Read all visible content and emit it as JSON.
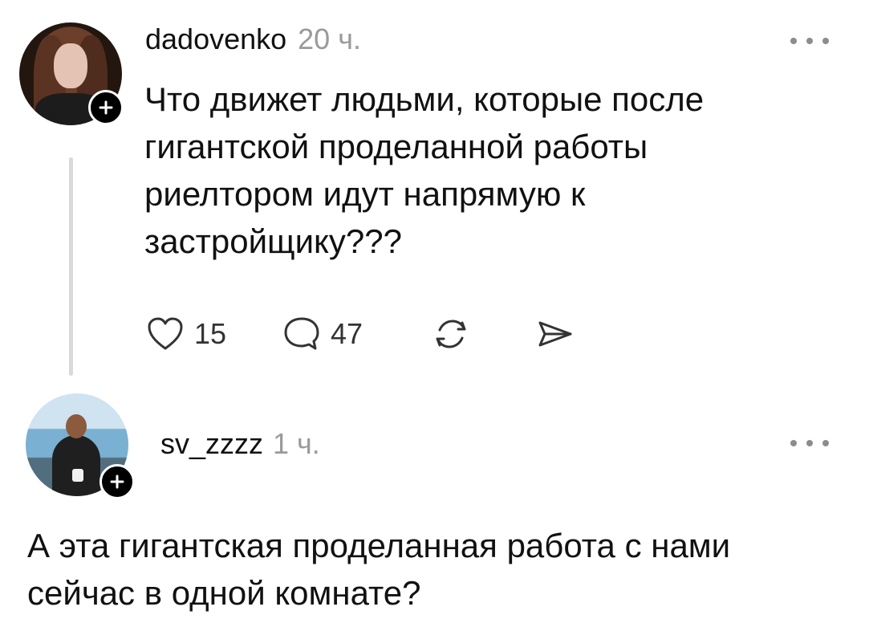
{
  "posts": [
    {
      "username": "dadovenko",
      "time": "20 ч.",
      "text": "Что движет людьми, которые после гигантской проделанной работы риелтором идут напрямую к застройщику???",
      "likes": "15",
      "comments": "47"
    },
    {
      "username": "sv_zzzz",
      "time": "1 ч.",
      "text": "А эта гигантская проделанная работа с нами сейчас в одной комнате?"
    }
  ],
  "icons": {
    "follow": "plus-icon",
    "more": "more-horizontal-icon",
    "like": "heart-icon",
    "comment": "comment-icon",
    "repost": "repost-icon",
    "share": "share-icon"
  },
  "colors": {
    "text": "#111111",
    "muted": "#9a9a9a",
    "thread": "#d9d9d9",
    "button_bg": "#000000"
  }
}
